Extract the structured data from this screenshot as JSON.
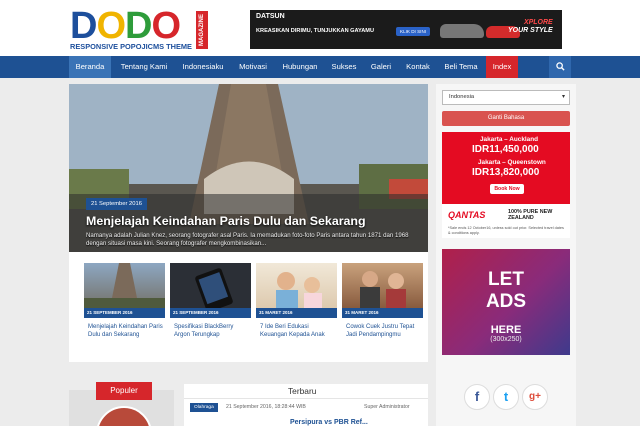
{
  "header": {
    "logo_word": "DODO",
    "logo_tagline": "RESPONSIVE POPOJICMS THEME",
    "logo_magazine": "MAGAZINE",
    "ad": {
      "brand": "DATSUN",
      "text": "KREASIKAN DIRIMU, TUNJUKKAN GAYAMU",
      "button": "KLIK DI SINI",
      "slogan_1": "XPLORE",
      "slogan_2": "YOUR STYLE"
    }
  },
  "nav": {
    "items": [
      {
        "label": "Beranda"
      },
      {
        "label": "Tentang Kami"
      },
      {
        "label": "Indonesiaku"
      },
      {
        "label": "Motivasi"
      },
      {
        "label": "Hubungan"
      },
      {
        "label": "Sukses"
      },
      {
        "label": "Galeri"
      },
      {
        "label": "Kontak"
      },
      {
        "label": "Beli Tema"
      },
      {
        "label": "Index"
      }
    ],
    "search_icon": "search-icon"
  },
  "hero": {
    "date": "21 September 2016",
    "title": "Menjelajah Keindahan Paris Dulu dan Sekarang",
    "desc": "Namanya adalah Julian Knez, seorang fotografer asal Paris. Ia memadukan foto-foto Paris antara tahun 1871 dan 1968 dengan situasi masa kini. Seorang fotografer mengkombinasikan..."
  },
  "cards": [
    {
      "date": "21 SEPTEMBER 2016",
      "title": "Menjelajah Keindahan Paris Dulu dan Sekarang"
    },
    {
      "date": "21 SEPTEMBER 2016",
      "title": "Spesifikasi BlackBerry Argon Terungkap"
    },
    {
      "date": "31 MARET 2016",
      "title": "7 Ide Beri Edukasi Keuangan Kepada Anak"
    },
    {
      "date": "31 MARET 2016",
      "title": "Cowok Cuek Justru Tepat Jadi Pendampingmu"
    }
  ],
  "sidebar": {
    "language_value": "Indonesia",
    "language_button": "Ganti Bahasa",
    "qantas": {
      "route1": "Jakarta – Auckland",
      "price1": "IDR11,450,000",
      "route2": "Jakarta – Queenstown",
      "price2": "IDR13,820,000",
      "book": "Book Now",
      "logo": "QANTAS",
      "tag": "100% PURE NEW ZEALAND",
      "small": "*Sale ends 12 October16, unless sold out prior. Selected travel dates & conditions apply."
    },
    "ad_placeholder": {
      "line1": "LET",
      "line2": "ADS",
      "line3": "HERE",
      "size": "(300x250)"
    }
  },
  "social": {
    "facebook": "f",
    "twitter": "t",
    "google": "g+"
  },
  "populer_label": "Populer",
  "terbaru": {
    "heading": "Terbaru",
    "tag": "Olahraga",
    "meta": "21 September 2016, 18:28:44 WIB",
    "author": "Super Administrator",
    "next_title": "Persipura vs PBR Ref..."
  },
  "colors": {
    "nav": "#1e5193",
    "accent": "#d6262b"
  }
}
